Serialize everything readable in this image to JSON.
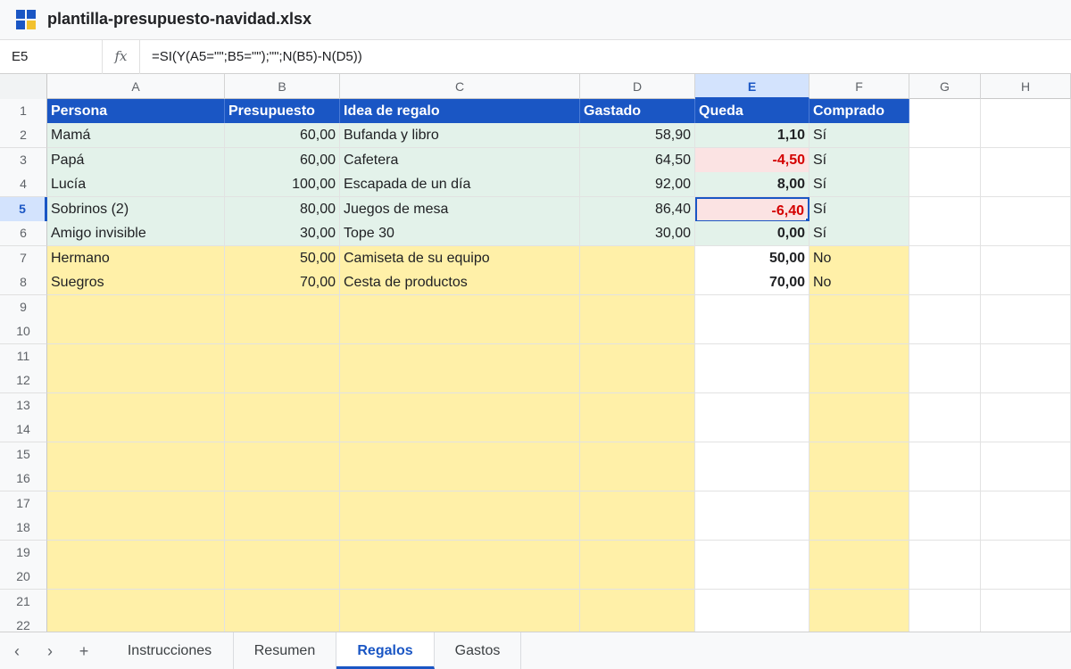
{
  "window": {
    "file_name": "plantilla-presupuesto-navidad.xlsx",
    "icon": "spreadsheet-app-icon"
  },
  "formula_bar": {
    "cell_ref": "E5",
    "fx_label": "fx",
    "formula": "=SI(Y(A5=\"\";B5=\"\");\"\";N(B5)-N(D5))"
  },
  "columns": [
    "A",
    "B",
    "C",
    "D",
    "E",
    "F",
    "G",
    "H"
  ],
  "selected_column": "E",
  "selected_row": "5",
  "header_row": {
    "number": "1",
    "cells": [
      "Persona",
      "Presupuesto",
      "Idea de regalo",
      "Gastado",
      "Queda",
      "Comprado"
    ]
  },
  "rows": [
    {
      "number": "2",
      "persona": "Mamá",
      "presupuesto": "60,00",
      "idea": "Bufanda y libro",
      "gastado": "58,90",
      "queda": "1,10",
      "comprado": "Sí",
      "queda_negative": false,
      "fill": "green"
    },
    {
      "number": "3",
      "persona": "Papá",
      "presupuesto": "60,00",
      "idea": "Cafetera",
      "gastado": "64,50",
      "queda": "-4,50",
      "comprado": "Sí",
      "queda_negative": true,
      "fill": "green"
    },
    {
      "number": "4",
      "persona": "Lucía",
      "presupuesto": "100,00",
      "idea": "Escapada de un día",
      "gastado": "92,00",
      "queda": "8,00",
      "comprado": "Sí",
      "queda_negative": false,
      "fill": "green"
    },
    {
      "number": "5",
      "persona": "Sobrinos (2)",
      "presupuesto": "80,00",
      "idea": "Juegos de mesa",
      "gastado": "86,40",
      "queda": "-6,40",
      "comprado": "Sí",
      "queda_negative": true,
      "fill": "green"
    },
    {
      "number": "6",
      "persona": "Amigo invisible",
      "presupuesto": "30,00",
      "idea": "Tope 30",
      "gastado": "30,00",
      "queda": "0,00",
      "comprado": "Sí",
      "queda_negative": false,
      "fill": "green"
    },
    {
      "number": "7",
      "persona": "Hermano",
      "presupuesto": "50,00",
      "idea": "Camiseta de su equipo",
      "gastado": "",
      "queda": "50,00",
      "comprado": "No",
      "queda_negative": false,
      "fill": "yellow"
    },
    {
      "number": "8",
      "persona": "Suegros",
      "presupuesto": "70,00",
      "idea": "Cesta de productos",
      "gastado": "",
      "queda": "70,00",
      "comprado": "No",
      "queda_negative": false,
      "fill": "yellow"
    }
  ],
  "empty_rows": [
    "9",
    "10",
    "11",
    "12",
    "13",
    "14",
    "15",
    "16",
    "17",
    "18",
    "19",
    "20",
    "21",
    "22"
  ],
  "sheet_nav": {
    "prev": "‹",
    "next": "›",
    "add": "+"
  },
  "tabs": [
    {
      "label": "Instrucciones",
      "active": false
    },
    {
      "label": "Resumen",
      "active": false
    },
    {
      "label": "Regalos",
      "active": true
    },
    {
      "label": "Gastos",
      "active": false
    }
  ],
  "colors": {
    "accent": "#1a56c4",
    "header_fill": "#1a56c4",
    "done_fill": "#e3f2ea",
    "pending_fill": "#fff0a8",
    "negative_text": "#d40000",
    "negative_fill": "#fbe3e3"
  }
}
